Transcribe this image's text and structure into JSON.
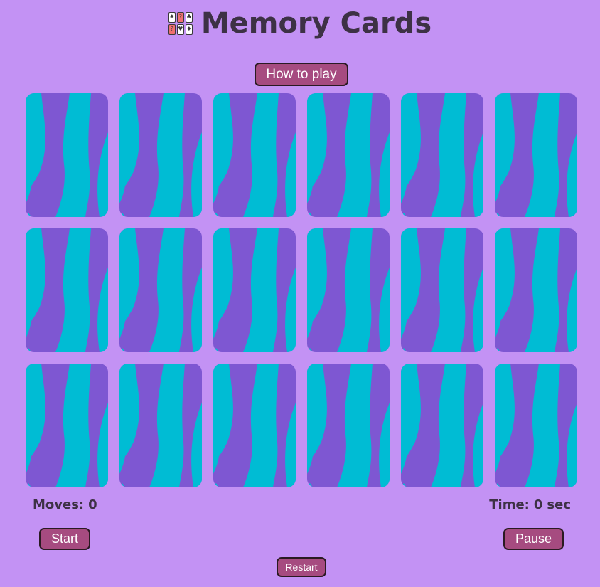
{
  "header": {
    "title": "Memory Cards",
    "logo_icon": "memory-cards-logo-icon",
    "logo_marks": [
      "?",
      "?"
    ]
  },
  "how_to_play": {
    "label": "How to play"
  },
  "board": {
    "rows": 3,
    "columns": 6,
    "card_state": "face-down",
    "card_back_colors": {
      "primary": "#7e57d2",
      "stripe": "#00bcd4"
    }
  },
  "stats": {
    "moves_label": "Moves:",
    "moves_value": "0",
    "time_label": "Time:",
    "time_value": "0",
    "time_unit": "sec"
  },
  "controls": {
    "start_label": "Start",
    "pause_label": "Pause",
    "restart_label": "Restart"
  },
  "colors": {
    "background": "#c392f4",
    "button": "#a64b80",
    "text": "#3d3145"
  }
}
